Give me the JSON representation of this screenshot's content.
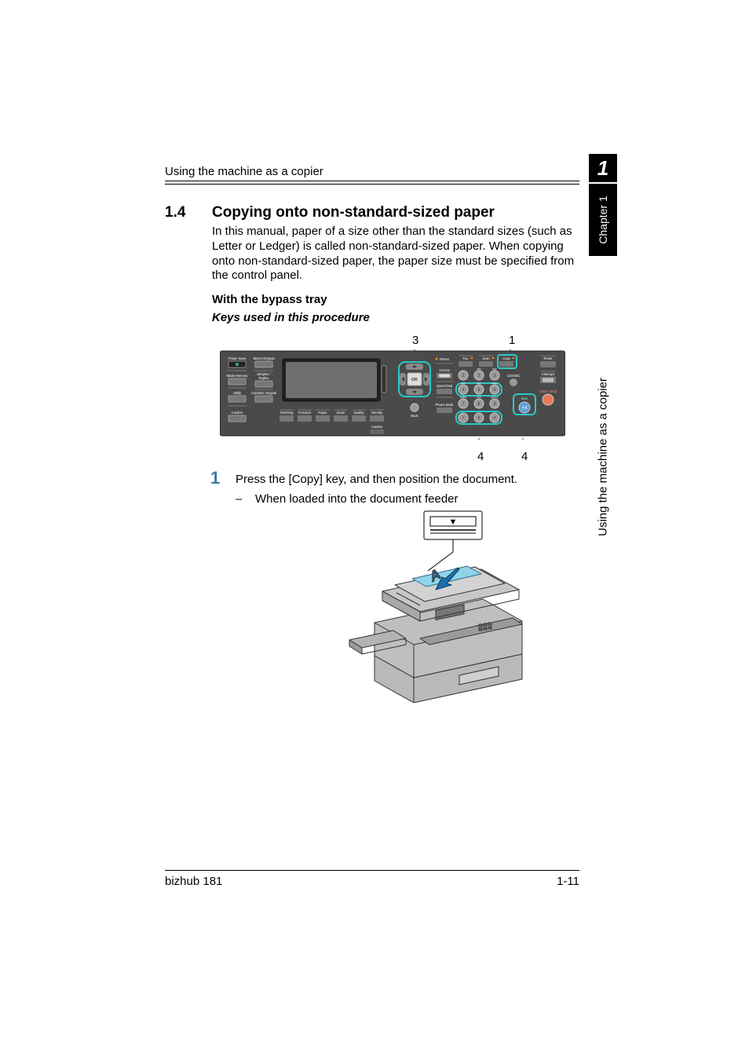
{
  "header": {
    "running_head": "Using the machine as a copier",
    "chapter_number": "1"
  },
  "side": {
    "tab": "Chapter 1",
    "label": "Using the machine as a copier"
  },
  "section": {
    "number": "1.4",
    "title": "Copying onto non-standard-sized paper",
    "intro": "In this manual, paper of a size other than the standard sizes (such as Letter or Ledger) is called non-standard-sized paper. When copying onto non-standard-sized paper, the paper size must be specified from the control panel.",
    "subhead": "With the bypass tray",
    "keys_heading": "Keys used in this procedure"
  },
  "callouts": {
    "top_left": "3",
    "top_right": "1",
    "bottom_left": "4",
    "bottom_right": "4"
  },
  "panel": {
    "left_col": [
      "Power Save",
      "Mode Memory",
      "Utility",
      "Confirm"
    ],
    "left_col2": [
      "Mixed Original",
      "Simplex / Duplex",
      "Combine Original"
    ],
    "bottom_row": [
      "Finishing",
      "Function",
      "Paper",
      "Zoom",
      "Quality",
      "Density"
    ],
    "bottom_extra": "Caution",
    "ok": "OK",
    "mid_right": [
      "Printer",
      "Access",
      "Speed Dial",
      "Phone Book",
      "Back"
    ],
    "top_right_row": [
      "Fax",
      "Scan",
      "Copy"
    ],
    "right_col": [
      "Reset",
      "Interrupt",
      "Clear / Stop",
      "Start",
      "123/ABC"
    ],
    "keypad_sub": [
      "ABC",
      "DEF",
      "GHI",
      "JKL",
      "MNO",
      "PQRS",
      "TUV",
      "WXYZ"
    ]
  },
  "steps": {
    "n1": "1",
    "t1": "Press the [Copy] key, and then position the document.",
    "sub1_dash": "–",
    "sub1": "When loaded into the document feeder"
  },
  "feeder": {
    "arrow_label": "▼",
    "page_letter": "A"
  },
  "footer": {
    "left": "bizhub 181",
    "right": "1-11"
  }
}
